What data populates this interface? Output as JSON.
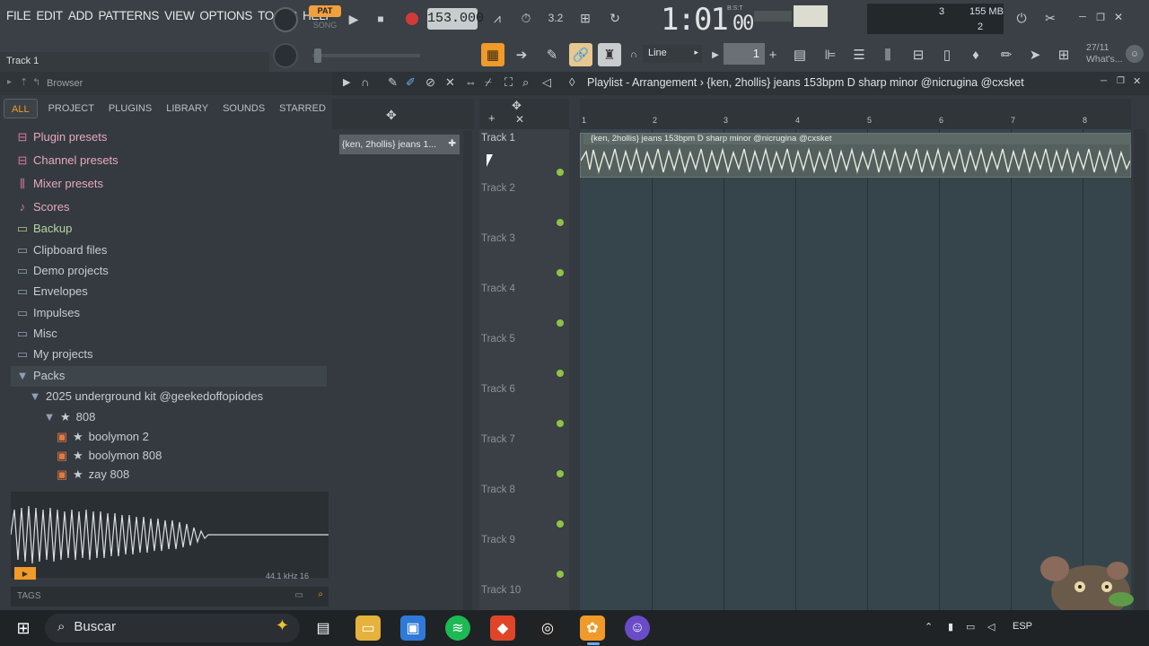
{
  "menu": [
    "FILE",
    "EDIT",
    "ADD",
    "PATTERNS",
    "VIEW",
    "OPTIONS",
    "TOOLS",
    "HELP"
  ],
  "hint": "Track 1",
  "transport": {
    "pat": "PAT",
    "song": "SONG",
    "tempo": "153.000",
    "time": "1:01",
    "time_sub": "00",
    "bst": "B:S:T"
  },
  "monitor": {
    "val1": "3",
    "mem": "155 MB",
    "val2": "2"
  },
  "toolbar2": {
    "snap": "Line",
    "pattern_num": "1"
  },
  "news": {
    "date": "27/11",
    "label": "What's..."
  },
  "browser": {
    "title": "Browser",
    "tabs": [
      "ALL",
      "PROJECT",
      "PLUGINS",
      "LIBRARY",
      "SOUNDS",
      "STARRED"
    ],
    "items": [
      {
        "label": "Plugin presets",
        "style": "pink"
      },
      {
        "label": "Channel presets",
        "style": "pink"
      },
      {
        "label": "Mixer presets",
        "style": "pink"
      },
      {
        "label": "Scores",
        "style": "pink"
      },
      {
        "label": "Backup",
        "style": "green"
      },
      {
        "label": "Clipboard files",
        "style": "normal"
      },
      {
        "label": "Demo projects",
        "style": "normal"
      },
      {
        "label": "Envelopes",
        "style": "normal"
      },
      {
        "label": "Impulses",
        "style": "normal"
      },
      {
        "label": "Misc",
        "style": "normal"
      },
      {
        "label": "My projects",
        "style": "normal"
      },
      {
        "label": "Packs",
        "style": "normal"
      },
      {
        "label": "2025 underground kit @geekedoffopiodes",
        "style": "normal"
      },
      {
        "label": "808",
        "style": "normal"
      },
      {
        "label": "boolymon 2",
        "style": "normal"
      },
      {
        "label": "boolymon 808",
        "style": "normal"
      },
      {
        "label": "zay 808",
        "style": "normal"
      }
    ],
    "wave_info": "44.1 kHz 16",
    "tags": "TAGS"
  },
  "playlist": {
    "title": "Playlist - Arrangement",
    "pattern": "{ken, 2hollis} jeans 153bpm D sharp minor @nicrugina @cxsket",
    "picker": "{ken, 2hollis} jeans 1...",
    "clip_title": "{ken, 2hollis} jeans 153bpm D sharp minor @nicrugina @cxsket",
    "bars": [
      "1",
      "2",
      "3",
      "4",
      "5",
      "6",
      "7",
      "8"
    ],
    "tracks": [
      "Track 1",
      "Track 2",
      "Track 3",
      "Track 4",
      "Track 5",
      "Track 6",
      "Track 7",
      "Track 8",
      "Track 9",
      "Track 10"
    ]
  },
  "taskbar": {
    "search": "Buscar",
    "lang": "ESP"
  },
  "colors": {
    "accent": "#f09a2a",
    "led": "#8fc246",
    "record": "#d23a3a"
  }
}
